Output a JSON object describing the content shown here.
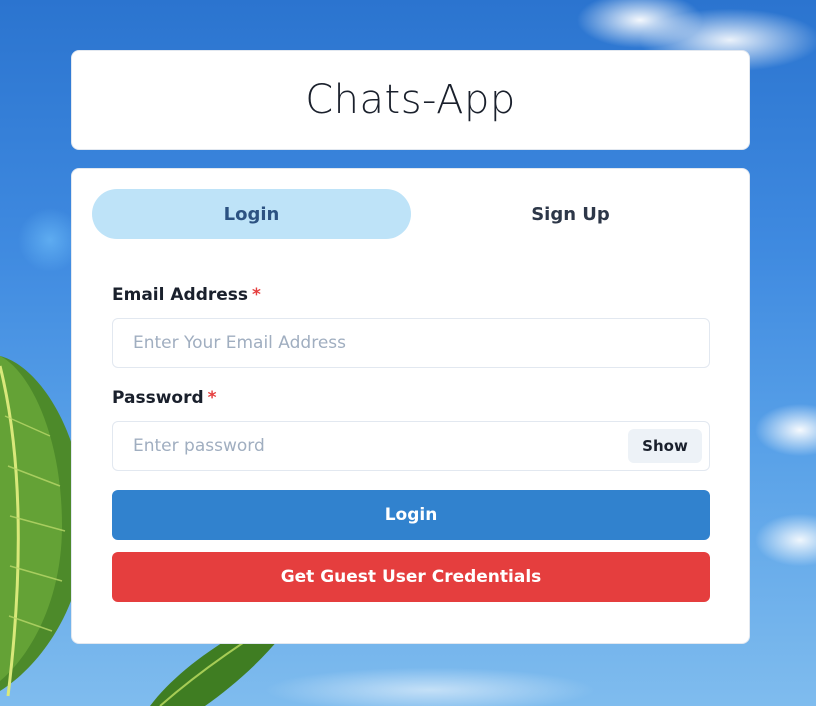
{
  "app": {
    "title": "Chats-App"
  },
  "tabs": [
    {
      "label": "Login",
      "active": true
    },
    {
      "label": "Sign Up",
      "active": false
    }
  ],
  "login_form": {
    "email": {
      "label": "Email Address",
      "required_marker": "*",
      "placeholder": "Enter Your Email Address",
      "value": ""
    },
    "password": {
      "label": "Password",
      "required_marker": "*",
      "placeholder": "Enter password",
      "value": "",
      "toggle_label": "Show"
    },
    "submit_label": "Login",
    "guest_label": "Get Guest User Credentials"
  },
  "colors": {
    "active_tab_bg": "#bee3f8",
    "login_button": "#3182ce",
    "guest_button": "#e53e3e",
    "required_marker": "#e53e3e"
  }
}
